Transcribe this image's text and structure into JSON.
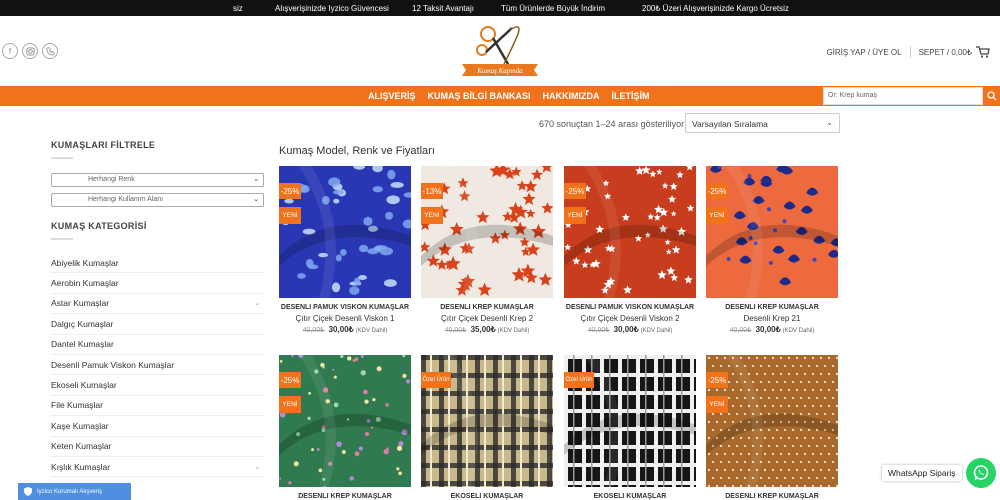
{
  "topbar": {
    "items": [
      "siz",
      "Alışverişinizde Iyzico Güvencesi",
      "12 Taksit Avantajı",
      "Tüm Ürünlerde Büyük İndirim",
      "200₺ Üzeri Alışverişinizde Kargo Ücretsiz"
    ]
  },
  "header": {
    "logo_text": "Kumaş Kapında",
    "login": "GİRİŞ YAP / ÜYE OL",
    "cart": "SEPET / 0,00₺",
    "social_icons": [
      "facebook-icon",
      "instagram-icon",
      "phone-icon"
    ]
  },
  "nav": {
    "links": [
      "ALIŞVERİŞ",
      "KUMAŞ BİLGİ BANKASI",
      "HAKKIMIZDA",
      "İLETİŞİM"
    ],
    "search_placeholder": "Or: Krep kumaş"
  },
  "results": {
    "count_text": "670 sonuçtan 1–24 arası gösteriliyor",
    "sort_value": "Varsayılan Sıralama"
  },
  "sidebar": {
    "filter_title": "KUMAŞLARI FİLTRELE",
    "color_select": "Herhangi Renk",
    "usage_select": "Herhangi Kullanım Alanı",
    "categories_title": "KUMAŞ KATEGORİSİ",
    "categories": [
      {
        "label": "Abiyelik Kumaşlar",
        "expandable": false
      },
      {
        "label": "Aerobin Kumaşlar",
        "expandable": false
      },
      {
        "label": "Astar Kumaşlar",
        "expandable": true
      },
      {
        "label": "Dalgıç Kumaşlar",
        "expandable": false
      },
      {
        "label": "Dantel Kumaşlar",
        "expandable": false
      },
      {
        "label": "Desenli Pamuk Viskon Kumaşlar",
        "expandable": false
      },
      {
        "label": "Ekoseli Kumaşlar",
        "expandable": false
      },
      {
        "label": "File Kumaşlar",
        "expandable": false
      },
      {
        "label": "Kaşe Kumaşlar",
        "expandable": false
      },
      {
        "label": "Keten Kumaşlar",
        "expandable": false
      },
      {
        "label": "Kışlık Kumaşlar",
        "expandable": true
      }
    ]
  },
  "main": {
    "title": "Kumaş Model, Renk ve Fiyatları",
    "new_label": "YENİ",
    "vat_label": "(KDV Dahil)",
    "products": [
      {
        "badge": "-25%",
        "is_new": true,
        "category": "DESENLİ PAMUK VİSKON KUMAŞLAR",
        "name": "Çıtır Çiçek Desenli Viskon 1",
        "old_price": "40,00₺",
        "price": "30,00₺",
        "pattern": "blue-floral"
      },
      {
        "badge": "-13%",
        "is_new": true,
        "category": "DESENLİ KREP KUMAŞLAR",
        "name": "Çıtır Çiçek Desenli Krep 2",
        "old_price": "40,00₺",
        "price": "35,00₺",
        "pattern": "red-star-white"
      },
      {
        "badge": "-25%",
        "is_new": true,
        "category": "DESENLİ PAMUK VİSKON KUMAŞLAR",
        "name": "Çıtır Çiçek Desenli Viskon 2",
        "old_price": "40,00₺",
        "price": "30,00₺",
        "pattern": "red-white-star"
      },
      {
        "badge": "-25%",
        "is_new": true,
        "category": "DESENLİ KREP KUMAŞLAR",
        "name": "Desenli Krep 21",
        "old_price": "40,00₺",
        "price": "30,00₺",
        "pattern": "coral-floral"
      },
      {
        "badge": "-25%",
        "is_new": true,
        "category": "DESENLİ KREP KUMAŞLAR",
        "name": "",
        "old_price": "",
        "price": "",
        "pattern": "green-floral"
      },
      {
        "badge": "Özel Ürün",
        "is_new": false,
        "category": "EKOSELİ KUMAŞLAR",
        "name": "",
        "old_price": "",
        "price": "",
        "pattern": "beige-plaid"
      },
      {
        "badge": "Özel Ürün",
        "is_new": false,
        "category": "EKOSELİ KUMAŞLAR",
        "name": "",
        "old_price": "",
        "price": "",
        "pattern": "black-plaid"
      },
      {
        "badge": "-25%",
        "is_new": true,
        "category": "DESENLİ KREP KUMAŞLAR",
        "name": "",
        "old_price": "",
        "price": "",
        "pattern": "brown-dots"
      }
    ]
  },
  "widgets": {
    "iyzico": "İyzico Korumalı Alışveriş",
    "whatsapp": "WhatsApp Sipariş"
  },
  "colors": {
    "accent": "#f0731c",
    "topbar": "#111111",
    "whatsapp": "#25d366"
  }
}
